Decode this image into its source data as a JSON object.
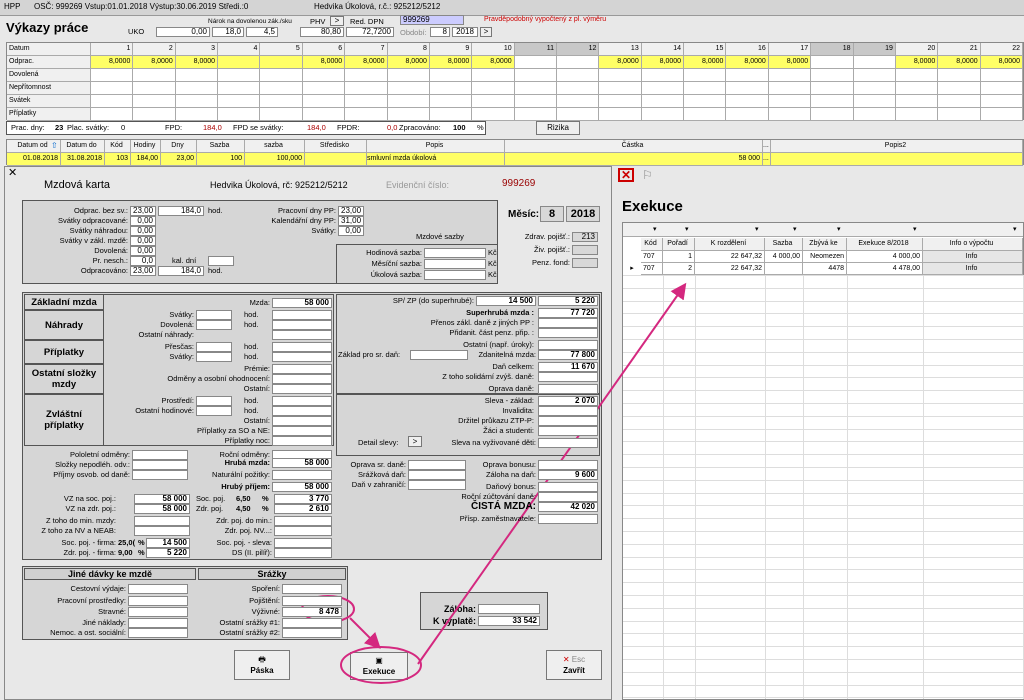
{
  "top": {
    "bar1_a": "HPP",
    "bar1_b": "OSČ: 999269  Vstup:01.01.2018 Výstup:30.06.2019 Středi.:0",
    "bar1_c": "Hedvika  Úkolová, r.č.: 925212/5212",
    "title": "Výkazy práce",
    "uko": "UKO",
    "narok": "Nárok na dovolenou zák./sku",
    "v1": "0,00",
    "v2": "18,0",
    "v3": "4,5",
    "phv": "PHV",
    "v4": "80,80",
    "red": "Red. DPN",
    "v5": "72,7200",
    "id": "999269",
    "warn": "Pravděpodobný vypočtený z pl. výměru",
    "obdobi": "Období:",
    "ob_v": "8",
    "year": "2018"
  },
  "grid": {
    "rows": [
      "Datum",
      "Odprac.",
      "Dovolená",
      "Nepřítomnost",
      "Svátek",
      "Příplatky"
    ],
    "days": [
      "1",
      "2",
      "3",
      "4",
      "5",
      "6",
      "7",
      "8",
      "9",
      "10",
      "11",
      "12",
      "13",
      "14",
      "15",
      "16",
      "17",
      "18",
      "19",
      "20",
      "21",
      "22"
    ],
    "odprac": [
      "8,0000",
      "8,0000",
      "8,0000",
      "",
      "",
      "8,0000",
      "8,0000",
      "8,0000",
      "8,0000",
      "8,0000",
      "",
      "",
      "8,0000",
      "8,0000",
      "8,0000",
      "8,0000",
      "8,0000",
      "",
      "",
      "8,0000",
      "8,0000",
      "8,0000"
    ]
  },
  "summary": {
    "pd": "Prac. dny:",
    "pd_v": "23",
    "ps": "Plac. svátky:",
    "ps_v": "0",
    "fpd": "FPD:",
    "fpd_v": "184,0",
    "fpds": "FPD se svátky:",
    "fpds_v": "184,0",
    "fpdr": "FPDR:",
    "fpdr_v": "0,0",
    "zpr": "Zpracováno:",
    "zpr_v": "100",
    "pct": "%",
    "rizika": "Rizika"
  },
  "tbl": {
    "h": [
      "Datum od",
      "Datum do",
      "Kód",
      "Hodiny",
      "Dny",
      "Sazba",
      "sazba",
      "Středisko",
      "Popis",
      "Částka",
      "...",
      "Popis2"
    ],
    "r": [
      "01.08.2018",
      "31.08.2018",
      "103",
      "184,00",
      "23,00",
      "100",
      "100,000",
      "",
      "smluvní mzda úkolová",
      "58 000",
      "...",
      ""
    ]
  },
  "mk": {
    "title": "Mzdová karta",
    "name": "Hedvika  Úkolová, rč: 925212/5212",
    "evid": "Evidenční číslo:",
    "evid_v": "999269",
    "a1": "Odprac. bez sv.:",
    "a1v": "23,00",
    "a1w": "184,0",
    "a1u": "hod.",
    "a2": "Svátky odpracované:",
    "a2v": "0,00",
    "a3": "Svátky náhradou:",
    "a3v": "0,00",
    "a4": "Svátky v zákl. mzdě:",
    "a4v": "0,00",
    "a5": "Dovolená:",
    "a5v": "0,00",
    "a6": "Pr. nesch.:",
    "a6v": "0,0",
    "a6k": "kal. dní",
    "a7": "Odpracováno:",
    "a7v": "23,00",
    "a7w": "184,0",
    "a7u": "hod.",
    "b1": "Pracovní dny PP:",
    "b1v": "23,00",
    "b2": "Kalendářní dny PP:",
    "b2v": "31,00",
    "b3": "Svátky:",
    "b3v": "0,00",
    "ms": "Měsíc:",
    "ms_v": "8",
    "ms_y": "2018",
    "zp": "Zdrav. pojišť.:",
    "zp_v": "213",
    "zv": "Živ. pojišť.:",
    "pf": "Penz. fond:",
    "sz": "Mzdové sazby",
    "h1": "Hodinová sazba:",
    "h2": "Měsíční sazba:",
    "h3": "Úkolová sazba:",
    "kc": "Kč",
    "zm": "Základní mzda",
    "mzda": "Mzda:",
    "mzda_v": "58 000",
    "nah": "Náhrady",
    "svatky": "Svátky:",
    "dovol": "Dovolená:",
    "ost_nah": "Ostatní náhrady:",
    "hod": "hod.",
    "prip": "Příplatky",
    "presc": "Přesčas:",
    "svatky2": "Svátky:",
    "osm": "Ostatní složky mzdy",
    "premie": "Prémie:",
    "odmeny": "Odměny a osobní ohodnocení:",
    "ostatni": "Ostatní:",
    "zvp": "Zvláštní příplatky",
    "prost": "Prostředí:",
    "osthod": "Ostatní hodinové:",
    "ostatni2": "Ostatní:",
    "psne": "Příplatky za SO a NE:",
    "pnoc": "Příplatky noc:",
    "polo": "Pololetní odměny:",
    "rocni": "Roční odměny:",
    "slozky": "Složky nepodléh. odv.:",
    "hruba": "Hrubá mzda:",
    "hruba_v": "58 000",
    "prijmy": "Příjmy osvob. od daně:",
    "natur": "Naturální požitky:",
    "hp": "Hrubý příjem:",
    "hp_v": "58 000",
    "vzs": "VZ na soc. poj.:",
    "vzs_v": "58 000",
    "vzz": "VZ na zdr. poj.:",
    "vzz_v": "58 000",
    "zmin": "Z toho do min. mzdy:",
    "znv": "Z toho za NV a NEAB:",
    "sf": "Soc. poj. - firma:",
    "sf_p": "25,0(",
    "sf_v": "14 500",
    "zf": "Zdr. poj. - firma:",
    "zf_p": "9,00",
    "zf_v": "5 220",
    "sp": "Soc. poj.",
    "sp_p": "6,50",
    "sp_v": "3 770",
    "zpp": "Zdr. poj.",
    "zp_p": "4,50",
    "zp_v2": "2 610",
    "zmin2": "Zdr. poj. do min.:",
    "znv2": "Zdr. poj. NV...:",
    "ssl": "Soc. poj. - sleva:",
    "ds": "DS (II. pilíř):",
    "pc": "%",
    "spzp": "SP/ ZP (do superhrubé):",
    "spzp_v1": "14 500",
    "spzp_v2": "5 220",
    "sup": "Superhrubá mzda :",
    "sup_v": "77 720",
    "prenos": "Přenos zákl. daně z jiných PP :",
    "pridan": "Přidanit. část penz. přip. :",
    "ostnap": "Ostatní (např. úroky):",
    "zakl": "Základ pro sr. daň:",
    "zdan": "Zdanitelná mzda:",
    "zdan_v": "77 800",
    "dan": "Daň celkem:",
    "dan_v": "11 670",
    "solid": "Z toho solidární zvýš. daně:",
    "oprava": "Oprava daně:",
    "sleva": "Sleva - základ:",
    "sleva_v": "2 070",
    "inval": "Invalidita:",
    "ztp": "Držitel průkazu ZTP-P:",
    "zaci": "Žáci a studenti:",
    "detail": "Detail slevy:",
    "det_btn": ">",
    "vyziv": "Sleva na vyživované děti:",
    "osd": "Oprava sr. daně:",
    "sdan": "Srážková daň:",
    "dzahr": "Daň v zahraničí:",
    "bonus": "Oprava bonusu:",
    "zaloha_d": "Záloha na daň:",
    "zaloha_dv": "9 600",
    "danbon": "Daňový bonus:",
    "rocnz": "Roční zúčtování daně:",
    "cista": "ČISTÁ MZDA:",
    "cista_v": "42 020",
    "prisp": "Přísp. zaměstnavatele:",
    "jd": "Jiné dávky ke mzdě",
    "cest": "Cestovní výdaje:",
    "pprost": "Pracovní prostředky:",
    "strav": "Stravné:",
    "jine": "Jiné náklady:",
    "nemoc": "Nemoc. a ost. sociální:",
    "sr": "Srážky",
    "spor": "Spoření:",
    "poj": "Pojištění:",
    "vyz": "Výživné:",
    "vyz_v": "8 478",
    "os1": "Ostatní srážky #1:",
    "os2": "Ostatní srážky #2:",
    "zal": "Záloha:",
    "kv": "K výplatě:",
    "kv_v": "33 542",
    "paska": "Páska",
    "exek": "Exekuce",
    "esc": "Esc",
    "zav": "Zavřít"
  },
  "ex": {
    "title": "Exekuce",
    "h": [
      "Kód",
      "Pořadí",
      "K rozdělení",
      "Sazba",
      "Zbývá ke sraž",
      "Exekuce 8/2018",
      "Info o výpočtu"
    ],
    "rows": [
      [
        "707",
        "1",
        "22 647,32",
        "4 000,00",
        "Neomezen",
        "4 000,00",
        "Info"
      ],
      [
        "707",
        "2",
        "22 647,32",
        "",
        "4478",
        "4 478,00",
        "Info"
      ]
    ]
  }
}
